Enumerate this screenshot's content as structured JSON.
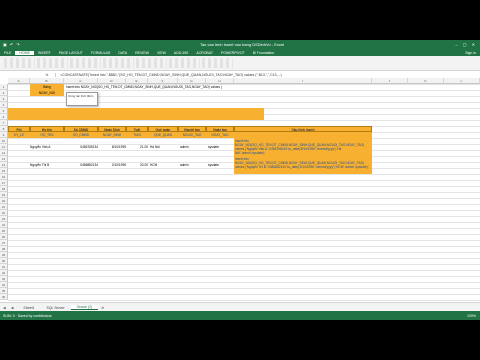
{
  "window": {
    "title": "Tao cau lenh insert vao bang DSDinhVu - Excel"
  },
  "ribbon": {
    "tabs": [
      "FILE",
      "HOME",
      "INSERT",
      "PAGE LAYOUT",
      "FORMULAS",
      "DATA",
      "REVIEW",
      "VIEW",
      "ADD-INS",
      "ACROBAT",
      "POWERPIVOT",
      "Bi Foundation"
    ],
    "signin": "Sign in"
  },
  "formula": {
    "namebox": "",
    "fx": "fx",
    "value": "=CONCATENATE(\"insert into \",$B$1,\"(SO_HO_TEN,DT_CMND,NGAY_SINH,QUE_QUAN,NGUOI_TAO,NGAY_TAO) values (\",B13,\",\",C13,...)"
  },
  "columns": [
    "A",
    "B",
    "C",
    "D",
    "E",
    "F",
    "G",
    "H",
    "I",
    "J",
    "K",
    "L"
  ],
  "rows": [
    "1",
    "2",
    "3",
    "4",
    "5",
    "6",
    "7",
    "8",
    "9",
    "10",
    "11",
    "12",
    "13",
    "14",
    "15",
    "16",
    "17",
    "18",
    "19",
    "20",
    "21",
    "22",
    "23",
    "24",
    "25",
    "26",
    "27",
    "28",
    "29",
    "30",
    "31",
    "32",
    "33",
    "34",
    "35",
    "36"
  ],
  "cells": {
    "b1": "Bảng",
    "b2": "NGAY_NOI",
    "c1": "insert into NGAY_NOI(SO_HO_TEN,DT_CMND,NGAY_SINH,QUE_QUAN,NGUOI_TAO,NGAY_TAO) values (",
    "tooltip": "Công tác thời điểm",
    "hdr": [
      "Phi",
      "Họ tên",
      "Số CMND",
      "Ngày Sinh",
      "Tuổi",
      "Quê quán",
      "Người tạo",
      "Ngày tạo",
      "Câu lệnh insert"
    ],
    "sub": [
      "KY_LE",
      "HO_TEN",
      "SO_CMND",
      "NGAY_SINH",
      "TUOI",
      "QUE_QUAN",
      "NGUOI_TAO",
      "NGAY_TAO",
      ""
    ],
    "rows": [
      {
        "name": "Nguyễn Văn A",
        "cmnd": "0456765134",
        "dob": "8/10/1995",
        "age": "21.00",
        "que": "Hà Nội",
        "user": "admin",
        "date": "sysdate",
        "sql": "insert into NGAY_NOI(SO_HO_TEN,DT_CMND,NGAY_SINH,QUE_QUAN,NGUOI_TAO,NGAY_TAO) values ('Nguyễn Văn A','0456765134',to_date('8/10/1995','mm/dd/yyyy'),'Hà Nội','admin',sysdate);"
      },
      {
        "name": "Nguyễn Thị B",
        "cmnd": "0456882134",
        "dob": "2/10/1996",
        "age": "20.00",
        "que": "HCM",
        "user": "admin",
        "date": "sysdate",
        "sql": "insert into NGAY_NOI(SO_HO_TEN,DT_CMND,NGAY_SINH,QUE_QUAN,NGUOI_TAO,NGAY_TAO) values ('Nguyễn Thị B','0456882134',to_date('2/10/1996','mm/dd/yyyy'),'HCM','admin',sysdate);"
      }
    ]
  },
  "sheets": {
    "tabs": [
      "Sheet1",
      "SQL Server",
      "Oracle (2)"
    ],
    "active": "Oracle (2)"
  },
  "status": {
    "left": "SUM: 0 · Saved by contributors",
    "zoom": "100%"
  },
  "colors": {
    "accent": "#217346",
    "highlight": "#f7b02f"
  }
}
